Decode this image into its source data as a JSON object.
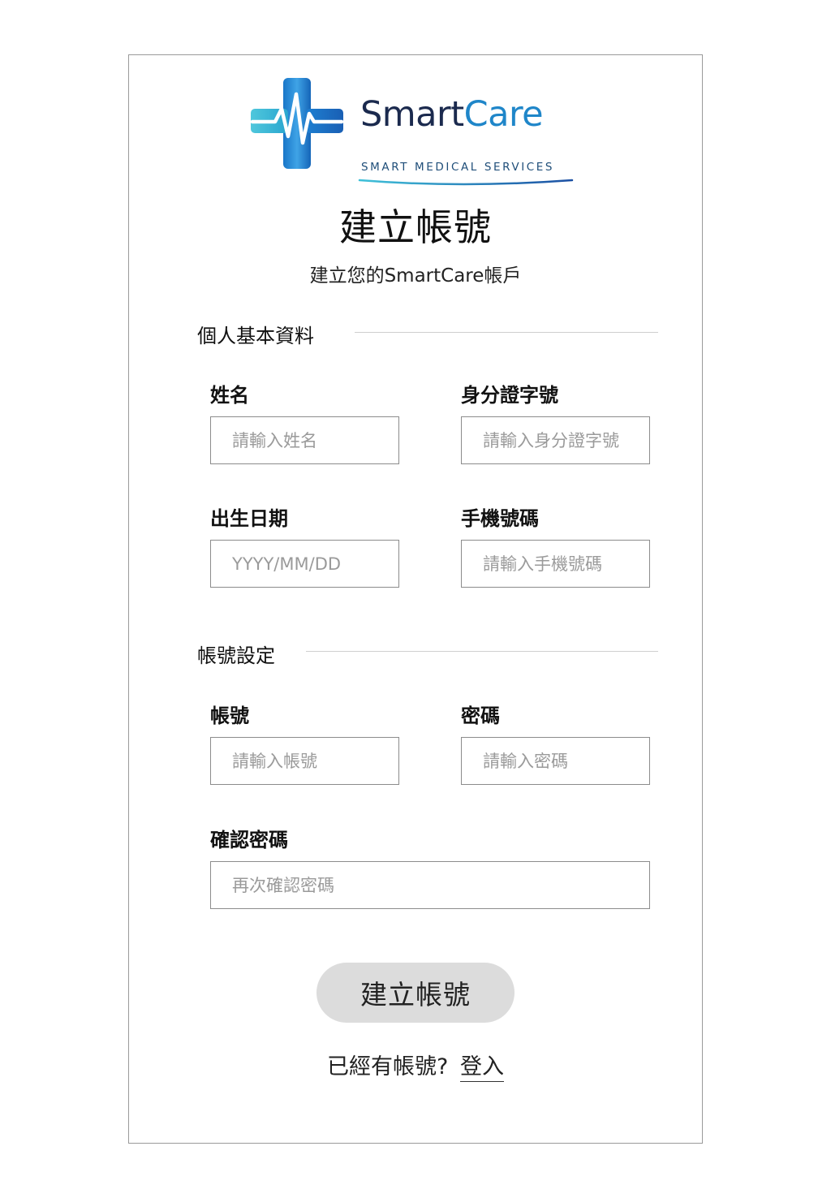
{
  "brand": {
    "name_part1": "Smart",
    "name_part2": "Care",
    "tagline": "SMART MEDICAL SERVICES",
    "colors": {
      "navy": "#1b2a4e",
      "blue": "#1f86c9",
      "cyan": "#3fc1d9"
    }
  },
  "header": {
    "title": "建立帳號",
    "subtitle": "建立您的SmartCare帳戶"
  },
  "sections": {
    "personal": {
      "title": "個人基本資料",
      "name": {
        "label": "姓名",
        "placeholder": "請輸入姓名"
      },
      "id_number": {
        "label": "身分證字號",
        "placeholder": "請輸入身分證字號"
      },
      "birthdate": {
        "label": "出生日期",
        "placeholder": "YYYY/MM/DD"
      },
      "phone": {
        "label": "手機號碼",
        "placeholder": "請輸入手機號碼"
      }
    },
    "account": {
      "title": "帳號設定",
      "username": {
        "label": "帳號",
        "placeholder": "請輸入帳號"
      },
      "password": {
        "label": "密碼",
        "placeholder": "請輸入密碼"
      },
      "confirm_password": {
        "label": "確認密碼",
        "placeholder": "再次確認密碼"
      }
    }
  },
  "actions": {
    "submit_label": "建立帳號",
    "have_account_text": "已經有帳號?",
    "login_label": "登入"
  }
}
